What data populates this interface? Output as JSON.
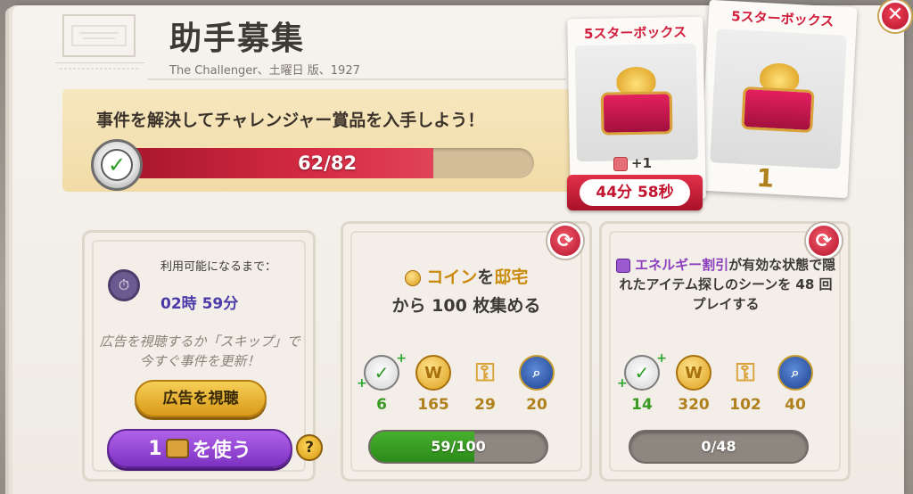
{
  "header": {
    "title": "助手募集",
    "subtitle": "The Challenger、土曜日 版、1927"
  },
  "goal": {
    "text": "事件を解決してチャレンジャー賞品を入手しよう！",
    "progress_text": "62/82",
    "current": 62,
    "total": 82
  },
  "prize": {
    "box_left_title": "5スターボックス",
    "box_right_title": "5スターボックス",
    "bonus_text": "+1",
    "timer": "44分 58秒",
    "count": "1"
  },
  "slot_left": {
    "available_label": "利用可能になるまで：",
    "available_time": "02時 59分",
    "ad_text": "広告を視聴するか「スキップ」で今すぐ事件を更新！",
    "watch_ad_label": "広告を視聴",
    "use_prefix": "1",
    "use_label": "を使う",
    "help_label": "?"
  },
  "task_mid": {
    "title_highlight": "コイン",
    "title_mid": "を",
    "title_highlight2": "邸宅",
    "title_line2": "から 100 枚集める",
    "rewards": [
      "6",
      "165",
      "29",
      "20"
    ],
    "progress_text": "59/100",
    "current": 59,
    "total": 100
  },
  "task_right": {
    "title_highlight": "エネルギー割引",
    "title_rest": "が有効な状態で隠れたアイテム探しのシーンを 48 回プレイする",
    "rewards": [
      "14",
      "320",
      "102",
      "40"
    ],
    "progress_text": "0/48",
    "current": 0,
    "total": 48
  },
  "icons": {
    "close": "close-icon",
    "refresh": "refresh-icon",
    "check": "check-icon",
    "coin": "coin-icon",
    "key": "key-icon",
    "lens": "magnifier-icon"
  },
  "colors": {
    "accent_red": "#d52a44",
    "gold": "#d99a18",
    "purple": "#7d32c2",
    "green": "#2c8a1b"
  }
}
